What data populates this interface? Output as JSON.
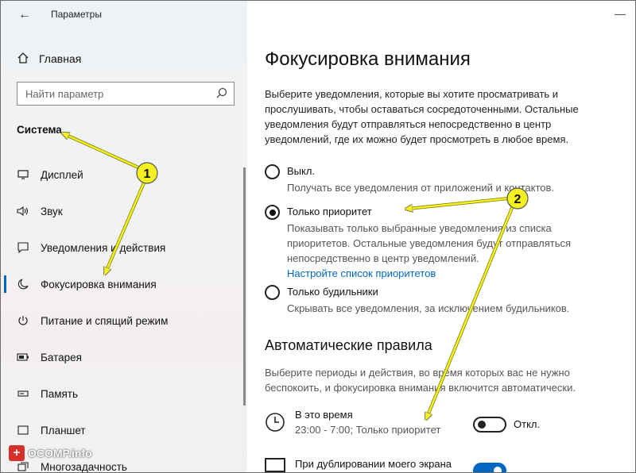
{
  "window": {
    "title": "Параметры"
  },
  "sidebar": {
    "home": "Главная",
    "search_placeholder": "Найти параметр",
    "section": "Система",
    "items": [
      {
        "label": "Дисплей",
        "icon": "monitor-icon"
      },
      {
        "label": "Звук",
        "icon": "speaker-icon"
      },
      {
        "label": "Уведомления и действия",
        "icon": "notification-icon"
      },
      {
        "label": "Фокусировка внимания",
        "icon": "moon-icon",
        "active": true
      },
      {
        "label": "Питание и спящий режим",
        "icon": "power-icon"
      },
      {
        "label": "Батарея",
        "icon": "battery-icon"
      },
      {
        "label": "Память",
        "icon": "storage-icon"
      },
      {
        "label": "Планшет",
        "icon": "tablet-icon"
      },
      {
        "label": "Многозадачность",
        "icon": "multitask-icon"
      }
    ]
  },
  "watermark": "OCOMP.info",
  "main": {
    "title": "Фокусировка внимания",
    "intro": "Выберите уведомления, которые вы хотите просматривать и прослушивать, чтобы оставаться сосредоточенными. Остальные уведомления будут отправляться непосредственно в центр уведомлений, где их можно будет просмотреть в любое время.",
    "options": [
      {
        "label": "Выкл.",
        "desc": "Получать все уведомления от приложений и контактов.",
        "checked": false
      },
      {
        "label": "Только приоритет",
        "desc": "Показывать только выбранные уведомления из списка приоритетов. Остальные уведомления будут отправляться непосредственно в центр уведомлений.",
        "link": "Настройте список приоритетов",
        "checked": true
      },
      {
        "label": "Только будильники",
        "desc": "Скрывать все уведомления, за исключением будильников.",
        "checked": false
      }
    ],
    "auto_title": "Автоматические правила",
    "auto_desc": "Выберите периоды и действия, во время которых вас не нужно беспокоить, и фокусировка внимания включится автоматически.",
    "rules": [
      {
        "title": "В это время",
        "sub": "23:00 - 7:00; Только приоритет",
        "toggle_label": "Откл.",
        "on": false
      },
      {
        "title": "При дублировании моего экрана",
        "sub": "",
        "toggle_label": "",
        "on": true
      }
    ]
  },
  "annotations": {
    "marker1": "1",
    "marker2": "2",
    "accent": "#f5f020"
  }
}
